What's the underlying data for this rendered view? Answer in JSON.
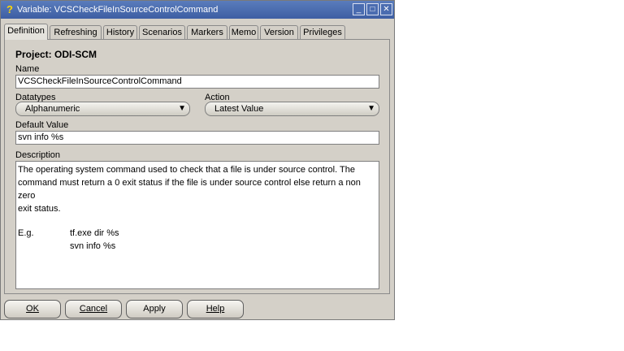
{
  "window": {
    "title": "Variable: VCSCheckFileInSourceControlCommand",
    "icon": "question-icon",
    "controls": {
      "minimize": "_",
      "maximize": "□",
      "close": "✕"
    }
  },
  "tabs": [
    "Definition",
    "Refreshing",
    "History",
    "Scenarios",
    "Markers",
    "Memo",
    "Version",
    "Privileges"
  ],
  "definition": {
    "project_label": "Project: ODI-SCM",
    "name_label": "Name",
    "name_value": "VCSCheckFileInSourceControlCommand",
    "datatypes_label": "Datatypes",
    "datatypes_value": "Alphanumeric",
    "action_label": "Action",
    "action_value": "Latest Value",
    "default_value_label": "Default Value",
    "default_value": "svn info %s",
    "description_label": "Description",
    "description_lines": [
      "The operating system command used to check that a file is under source control. The",
      "command must return a 0 exit status if the file is under source control else return a non zero",
      "exit status."
    ],
    "example_label": "E.g.",
    "example_lines": [
      "tf.exe dir %s",
      "svn info %s"
    ]
  },
  "buttons": {
    "ok": "OK",
    "cancel": "Cancel",
    "apply": "Apply",
    "help": "Help"
  }
}
